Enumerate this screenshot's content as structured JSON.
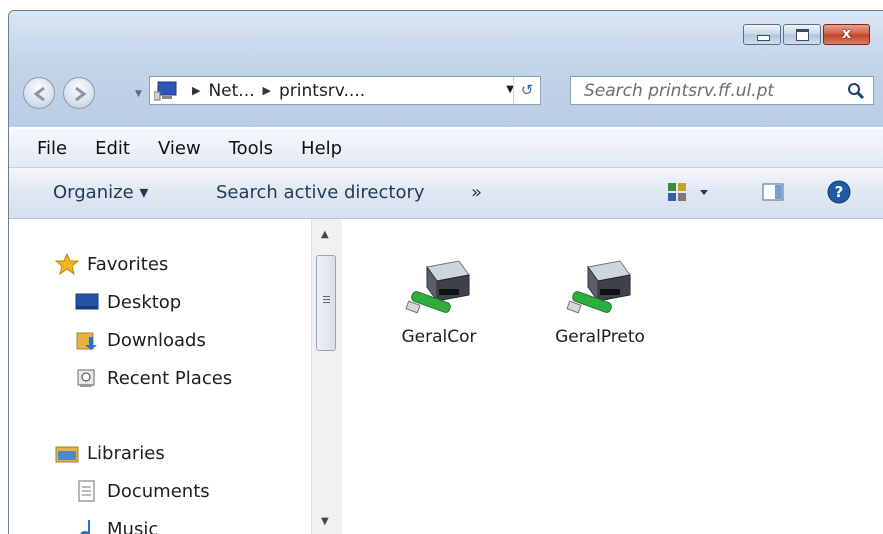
{
  "window": {
    "caption": {
      "minimize_label": "",
      "maximize_label": "",
      "close_label": "x"
    }
  },
  "address": {
    "crumbs": [
      "Net...",
      "printsrv...."
    ],
    "search_placeholder": "Search printsrv.ff.ul.pt"
  },
  "menu": [
    "File",
    "Edit",
    "View",
    "Tools",
    "Help"
  ],
  "toolbar": {
    "organize": "Organize ▾",
    "search_ad": "Search active directory",
    "more": "»"
  },
  "navpane": {
    "favorites": "Favorites",
    "desktop": "Desktop",
    "downloads": "Downloads",
    "recent": "Recent Places",
    "libraries": "Libraries",
    "documents": "Documents",
    "music": "Music"
  },
  "files": [
    {
      "name": "GeralCor"
    },
    {
      "name": "GeralPreto"
    }
  ],
  "colors": {
    "accent": "#3c6db0",
    "close": "#c23f27",
    "printer_cable": "#2fae3f"
  }
}
